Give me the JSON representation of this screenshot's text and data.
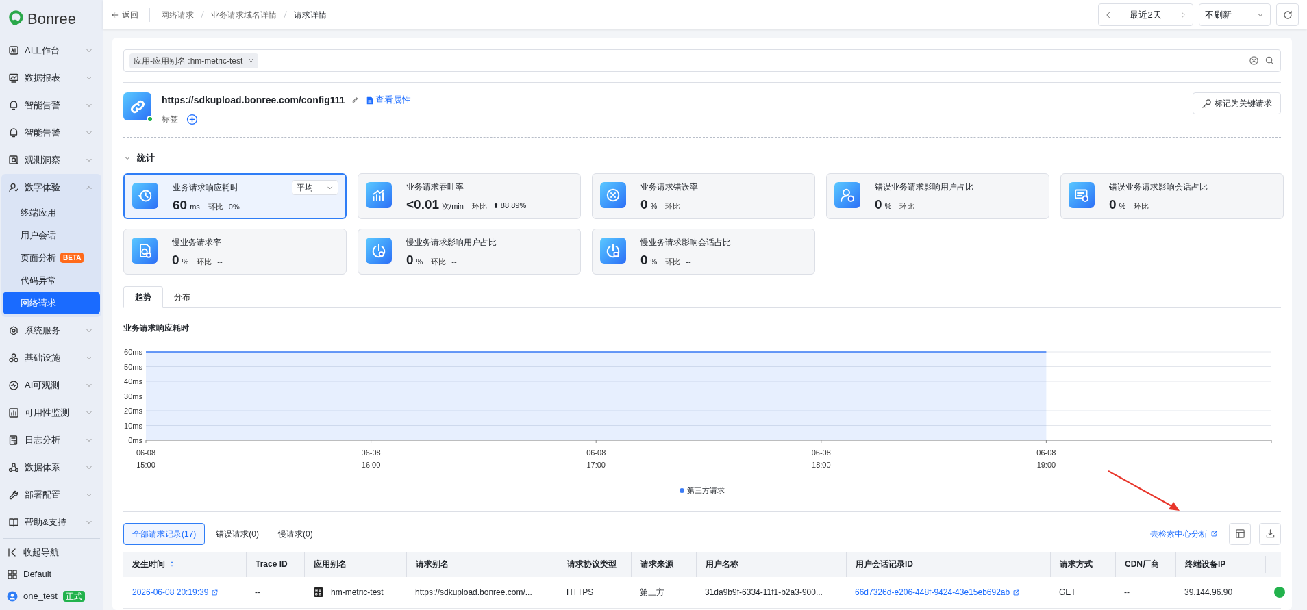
{
  "sidebar": {
    "logo": "Bonree",
    "items": [
      {
        "label": "AI工作台",
        "expanded": false
      },
      {
        "label": "数据报表",
        "expanded": false
      },
      {
        "label": "智能告警",
        "expanded": false
      },
      {
        "label": "智能告警",
        "expanded": false
      },
      {
        "label": "观测洞察",
        "expanded": false
      },
      {
        "label": "数字体验",
        "expanded": true,
        "children": [
          {
            "label": "终端应用",
            "selected": false
          },
          {
            "label": "用户会话",
            "selected": false
          },
          {
            "label": "页面分析",
            "badge": "BETA",
            "selected": false
          },
          {
            "label": "代码异常",
            "selected": false
          },
          {
            "label": "网络请求",
            "selected": true
          }
        ]
      },
      {
        "label": "系统服务",
        "expanded": false
      },
      {
        "label": "基础设施",
        "expanded": false
      },
      {
        "label": "AI可观测",
        "expanded": false
      },
      {
        "label": "可用性监测",
        "expanded": false
      },
      {
        "label": "日志分析",
        "expanded": false
      },
      {
        "label": "数据体系",
        "expanded": false
      },
      {
        "label": "部署配置",
        "expanded": false
      },
      {
        "label": "帮助&支持",
        "expanded": false
      }
    ],
    "footer": [
      {
        "kind": "collapse",
        "label": "收起导航"
      },
      {
        "kind": "workspace",
        "label": "Default"
      },
      {
        "kind": "user",
        "label": "one_test",
        "badge": "正式"
      }
    ]
  },
  "header": {
    "back": "返回",
    "breadcrumbs": [
      "网络请求",
      "业务请求域名详情",
      "请求详情"
    ],
    "time_range": "最近2天",
    "refresh": "不刷新"
  },
  "filter": {
    "tags": [
      "应用-应用别名 :hm-metric-test"
    ]
  },
  "request": {
    "url": "https://sdkupload.bonree.com/config111",
    "properties_link": "查看属性",
    "tags_label": "标签",
    "mark_button": "标记为关键请求"
  },
  "stats": {
    "title": "统计",
    "expanded": true,
    "cards": [
      {
        "title": "业务请求响应耗时",
        "value": "60",
        "unit": "ms",
        "compare": "环比",
        "change": "0%",
        "rising": false,
        "aggregate": "平均",
        "selected": true
      },
      {
        "title": "业务请求吞吐率",
        "value": "<0.01",
        "unit": "次/min",
        "compare": "环比",
        "change": "88.89%",
        "rising": true,
        "selected": false
      },
      {
        "title": "业务请求错误率",
        "value": "0",
        "unit": "%",
        "compare": "环比",
        "change": "--",
        "rising": false,
        "selected": false
      },
      {
        "title": "错误业务请求影响用户占比",
        "value": "0",
        "unit": "%",
        "compare": "环比",
        "change": "--",
        "rising": false,
        "selected": false
      },
      {
        "title": "错误业务请求影响会话占比",
        "value": "0",
        "unit": "%",
        "compare": "环比",
        "change": "--",
        "rising": false,
        "selected": false
      },
      {
        "title": "慢业务请求率",
        "value": "0",
        "unit": "%",
        "compare": "环比",
        "change": "--",
        "rising": false,
        "selected": false
      },
      {
        "title": "慢业务请求影响用户占比",
        "value": "0",
        "unit": "%",
        "compare": "环比",
        "change": "--",
        "rising": false,
        "selected": false
      },
      {
        "title": "慢业务请求影响会话占比",
        "value": "0",
        "unit": "%",
        "compare": "环比",
        "change": "--",
        "rising": false,
        "selected": false
      }
    ]
  },
  "view_tabs": [
    {
      "label": "趋势",
      "selected": true
    },
    {
      "label": "分布",
      "selected": false
    }
  ],
  "chart": {
    "chart_data": {
      "type": "area",
      "title": "业务请求响应耗时",
      "categories": [
        "06-08 15:00",
        "06-08 16:00",
        "06-08 17:00",
        "06-08 18:00",
        "06-08 19:00"
      ],
      "series": [
        {
          "name": "第三方请求",
          "color": "#3b7cf6",
          "values": [
            60,
            60,
            60,
            60,
            60
          ]
        }
      ],
      "ylim": [
        0,
        60
      ],
      "grid": true,
      "yticks": [
        {
          "value": 0,
          "label": "0ms"
        },
        {
          "value": 10,
          "label": "10ms"
        },
        {
          "value": 20,
          "label": "20ms"
        },
        {
          "value": 30,
          "label": "30ms"
        },
        {
          "value": 40,
          "label": "40ms"
        },
        {
          "value": 50,
          "label": "50ms"
        },
        {
          "value": 60,
          "label": "60ms"
        }
      ]
    }
  },
  "records": {
    "tabs": [
      {
        "label": "全部请求记录(17)",
        "selected": true
      },
      {
        "label": "错误请求(0)",
        "selected": false
      },
      {
        "label": "慢请求(0)",
        "selected": false
      }
    ],
    "search_link": "去检索中心分析",
    "columns": [
      {
        "label": "发生时间",
        "sortable": true
      },
      {
        "label": "Trace ID",
        "sortable": false
      },
      {
        "label": "应用别名",
        "sortable": false
      },
      {
        "label": "请求别名",
        "sortable": false
      },
      {
        "label": "请求协议类型",
        "sortable": false
      },
      {
        "label": "请求来源",
        "sortable": false
      },
      {
        "label": "用户名称",
        "sortable": false
      },
      {
        "label": "用户会话记录ID",
        "sortable": false
      },
      {
        "label": "请求方式",
        "sortable": false
      },
      {
        "label": "CDN厂商",
        "sortable": false
      },
      {
        "label": "终端设备IP",
        "sortable": false
      }
    ],
    "rows": [
      [
        {
          "kind": "link",
          "text": "2026-06-08 20:19:39"
        },
        {
          "kind": "text",
          "text": "--"
        },
        {
          "kind": "app",
          "text": "hm-metric-test"
        },
        {
          "kind": "text",
          "text": "https://sdkupload.bonree.com/..."
        },
        {
          "kind": "text",
          "text": "HTTPS"
        },
        {
          "kind": "text",
          "text": "第三方"
        },
        {
          "kind": "text",
          "text": "31da9b9f-6334-11f1-b2a3-900..."
        },
        {
          "kind": "link",
          "text": "66d7326d-e206-448f-9424-43e15eb692ab"
        },
        {
          "kind": "text",
          "text": "GET"
        },
        {
          "kind": "text",
          "text": "--"
        },
        {
          "kind": "text",
          "text": "39.144.96.90"
        },
        {
          "kind": "status",
          "color": "#22b24c"
        }
      ]
    ]
  }
}
